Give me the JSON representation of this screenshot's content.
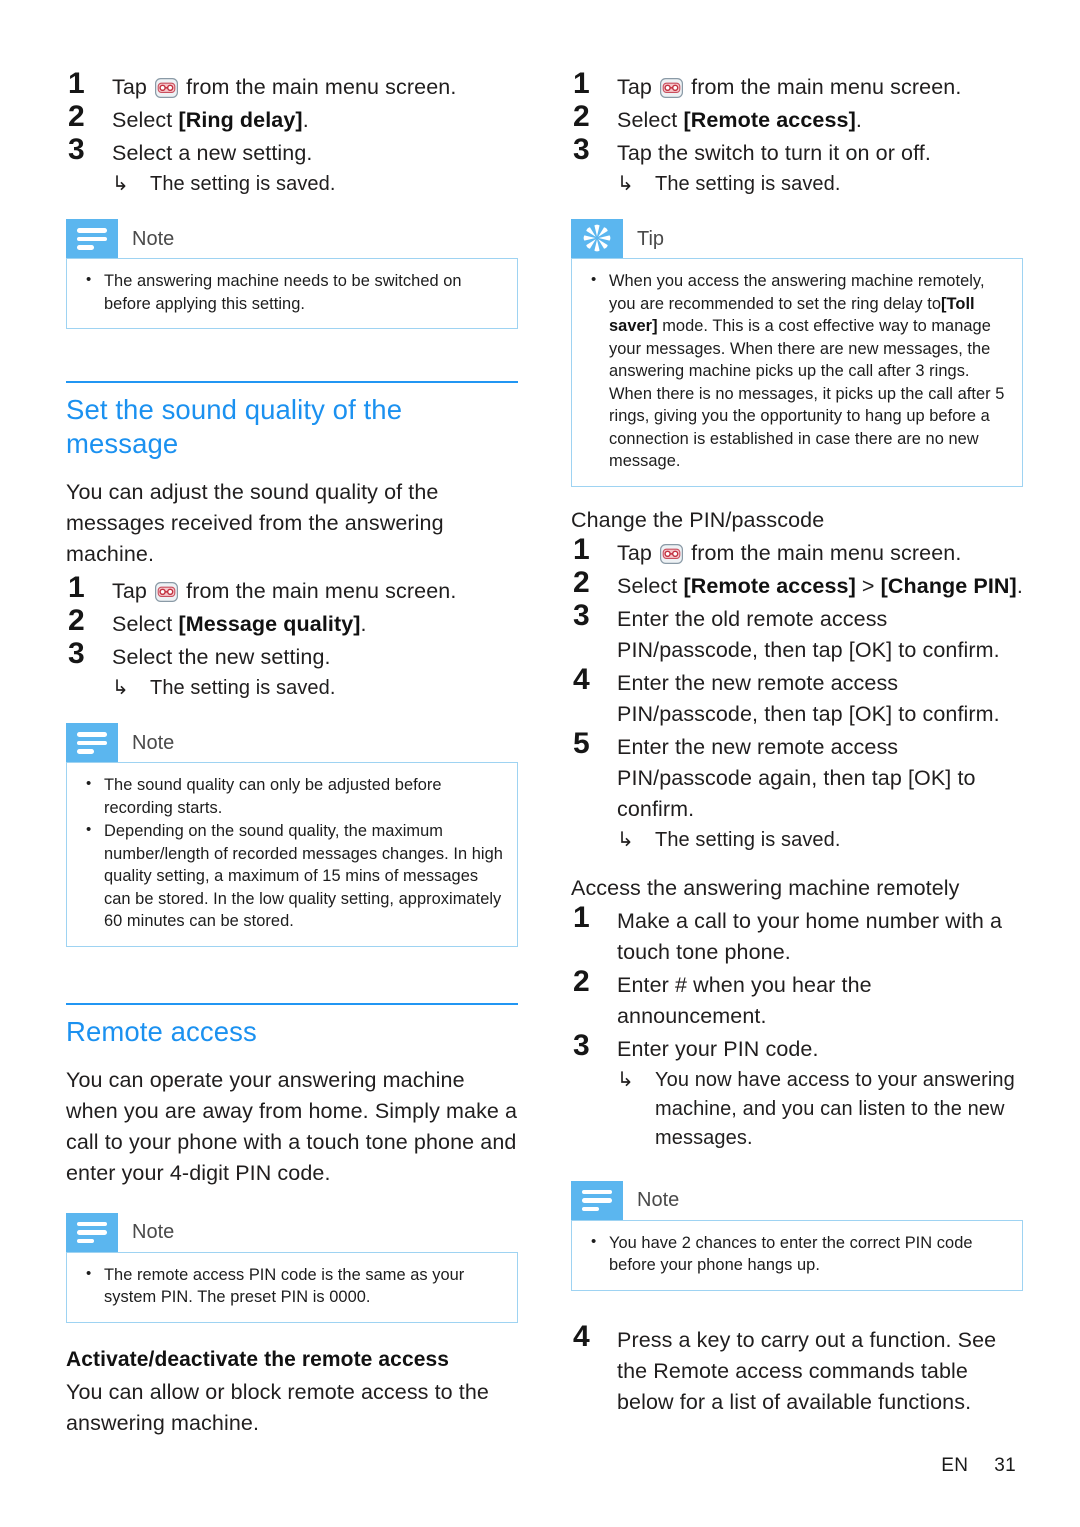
{
  "page": {
    "language": "EN",
    "number": "31"
  },
  "icons": {
    "answering_machine": "answering-machine-icon",
    "note_badge": "note-lines-icon",
    "tip_badge": "tip-asterisk-icon",
    "sub_arrow": "↳"
  },
  "left_column": {
    "ring_delay_steps": [
      {
        "num": "1",
        "pre": "Tap ",
        "post": " from the main menu screen.",
        "has_icon": true
      },
      {
        "num": "2",
        "pre": "Select ",
        "bold": "[Ring delay]",
        "post": "."
      },
      {
        "num": "3",
        "pre": "Select a new setting.",
        "sub": "The setting is saved."
      }
    ],
    "note_ring_delay": {
      "title": "Note",
      "items": [
        "The answering machine needs to be switched on before applying this setting."
      ]
    },
    "sound_quality_section": {
      "title": "Set the sound quality of the message",
      "intro": "You can adjust the sound quality of the messages received from the answering machine.",
      "steps": [
        {
          "num": "1",
          "pre": "Tap ",
          "post": " from the main menu screen.",
          "has_icon": true
        },
        {
          "num": "2",
          "pre": "Select ",
          "bold": "[Message quality]",
          "post": "."
        },
        {
          "num": "3",
          "pre": "Select the new setting.",
          "sub": "The setting is saved."
        }
      ]
    },
    "note_sound_quality": {
      "title": "Note",
      "items": [
        "The sound quality can only be adjusted before recording starts.",
        "Depending on the sound quality, the maximum number/length of recorded messages changes. In high quality setting, a maximum of 15 mins of messages can be stored. In the low quality setting, approximately 60 minutes can be stored."
      ]
    },
    "remote_access_section": {
      "title": "Remote access",
      "intro": "You can operate your answering machine when you are away from home. Simply make a call to your phone with a touch tone phone and enter your 4-digit PIN code."
    },
    "note_remote_access": {
      "title": "Note",
      "items": [
        "The remote access PIN code is the same as your system PIN. The preset PIN is 0000."
      ]
    },
    "activate_subsection": {
      "title": "Activate/deactivate the remote access",
      "intro": "You can allow or block remote access to the answering machine."
    }
  },
  "right_column": {
    "activate_steps": [
      {
        "num": "1",
        "pre": "Tap ",
        "post": " from the main menu screen.",
        "has_icon": true
      },
      {
        "num": "2",
        "pre": "Select ",
        "bold": "[Remote access]",
        "post": "."
      },
      {
        "num": "3",
        "pre": "Tap the switch to turn it on or off.",
        "sub": "The setting is saved."
      }
    ],
    "tip": {
      "title": "Tip",
      "item_part1": "When you access the answering machine remotely, you are recommended to set the ring delay to",
      "item_bold": "[Toll saver]",
      "item_part2": " mode. This is a cost effective way to manage your messages. When there are new messages, the answering machine picks up the call after 3 rings. When there is no messages, it picks up the call after 5 rings, giving you the opportunity to hang up before a connection is established in case there are no new message."
    },
    "change_pin_subsection": {
      "title": "Change the PIN/passcode",
      "steps": [
        {
          "num": "1",
          "pre": "Tap ",
          "post": " from the main menu screen.",
          "has_icon": true
        },
        {
          "num": "2",
          "pre": "Select ",
          "bold": "[Remote access]",
          "mid": " > ",
          "bold2": "[Change PIN]",
          "post": "."
        },
        {
          "num": "3",
          "pre": "Enter the old remote access PIN/passcode, then tap ",
          "bold": "[OK]",
          "post": " to confirm."
        },
        {
          "num": "4",
          "pre": "Enter the new remote access PIN/passcode, then tap ",
          "bold": "[OK]",
          "post": " to confirm."
        },
        {
          "num": "5",
          "pre": "Enter the new remote access PIN/passcode again, then tap ",
          "bold": "[OK]",
          "post": " to confirm.",
          "sub": "The setting is saved."
        }
      ]
    },
    "access_remotely_subsection": {
      "title": "Access the answering machine remotely",
      "steps": [
        {
          "num": "1",
          "pre": "Make a call to your home number with a touch tone phone."
        },
        {
          "num": "2",
          "pre": "Enter # when you hear the announcement."
        },
        {
          "num": "3",
          "pre": "Enter your PIN code.",
          "sub": "You now have access to your answering machine, and you can listen to the new messages."
        }
      ]
    },
    "note_pin_chances": {
      "title": "Note",
      "items": [
        "You have 2 chances to enter the correct PIN code before your phone hangs up."
      ]
    },
    "final_step": {
      "num": "4",
      "pre": "Press a key to carry out a function. See the Remote access commands table below for a list of available functions."
    }
  },
  "colors": {
    "heading_blue": "#1b91f0",
    "badge_blue": "#5bb6ef",
    "box_border": "#9ed3f2",
    "rule_blue": "#2196f3"
  }
}
